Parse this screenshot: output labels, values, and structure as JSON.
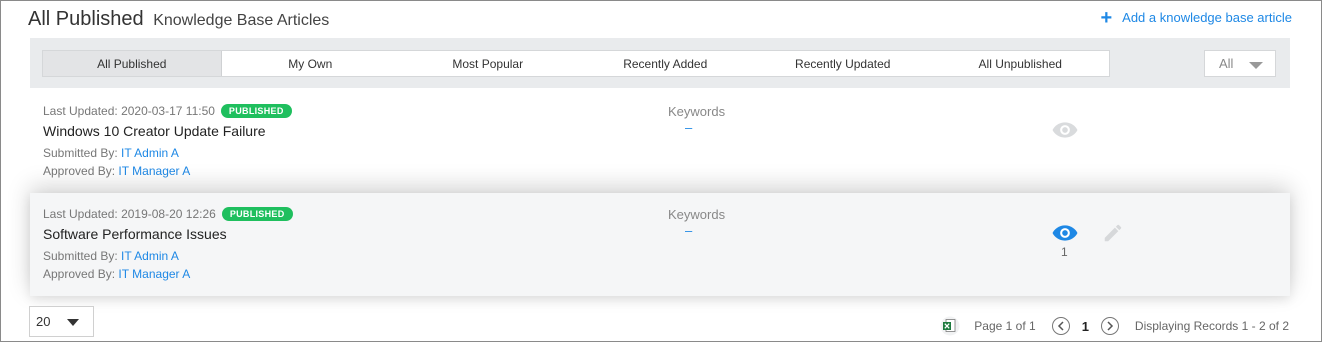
{
  "header": {
    "title": "All Published",
    "subtitle": "Knowledge Base Articles",
    "add_link": "Add a knowledge base article"
  },
  "tabs": [
    {
      "label": "All Published",
      "active": true
    },
    {
      "label": "My Own",
      "active": false
    },
    {
      "label": "Most Popular",
      "active": false
    },
    {
      "label": "Recently Added",
      "active": false
    },
    {
      "label": "Recently Updated",
      "active": false
    },
    {
      "label": "All Unpublished",
      "active": false
    }
  ],
  "filter": {
    "selected": "All"
  },
  "articles": [
    {
      "last_updated_label": "Last Updated:",
      "last_updated": "2020-03-17 11:50",
      "status": "PUBLISHED",
      "title": "Windows 10 Creator Update Failure",
      "submitted_label": "Submitted By:",
      "submitted_by": "IT Admin A",
      "approved_label": "Approved By:",
      "approved_by": "IT Manager A",
      "keywords_label": "Keywords",
      "keywords": "–",
      "views": ""
    },
    {
      "last_updated_label": "Last Updated:",
      "last_updated": "2019-08-20 12:26",
      "status": "PUBLISHED",
      "title": "Software Performance Issues",
      "submitted_label": "Submitted By:",
      "submitted_by": "IT Admin A",
      "approved_label": "Approved By:",
      "approved_by": "IT Manager A",
      "keywords_label": "Keywords",
      "keywords": "–",
      "views": "1"
    }
  ],
  "footer": {
    "page_size": "20",
    "page_info": "Page 1 of 1",
    "current_page": "1",
    "records": "Displaying Records 1 - 2 of 2"
  },
  "colors": {
    "accent": "#1e88e5",
    "badge": "#1fbf5e",
    "tabbar_bg": "#e9ebed",
    "eye_inactive": "#d9dbdd"
  },
  "icons": [
    "plus-icon",
    "chevron-down-icon",
    "eye-icon",
    "pencil-icon",
    "excel-icon",
    "chevron-left-icon",
    "chevron-right-icon"
  ]
}
